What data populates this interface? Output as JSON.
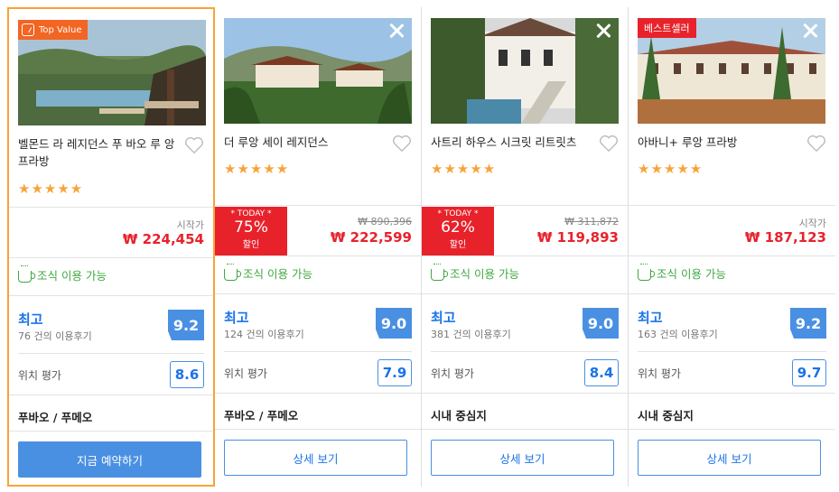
{
  "cards": [
    {
      "badge": "Top Value",
      "name": "벨몬드 라 레지던스 푸 바오 루 앙 프라방",
      "stars": "★★★★★",
      "start_label": "시작가",
      "price": "₩ 224,454",
      "breakfast": "조식 이용 가능",
      "rating_word": "최고",
      "reviews": "76 건의 이용후기",
      "score": "9.2",
      "location_label": "위치 평가",
      "location_score": "8.6",
      "area": "푸바오 / 푸메오",
      "button": "지금 예약하기"
    },
    {
      "name": "더 루앙 세이 레지던스",
      "stars": "★★★★★",
      "deal_today": "* TODAY *",
      "deal_percent": "75%",
      "deal_off": "할인",
      "original_price": "₩ 890,396",
      "price": "₩ 222,599",
      "breakfast": "조식 이용 가능",
      "rating_word": "최고",
      "reviews": "124 건의 이용후기",
      "score": "9.0",
      "location_label": "위치 평가",
      "location_score": "7.9",
      "area": "푸바오 / 푸메오",
      "button": "상세 보기"
    },
    {
      "name": "사트리 하우스 시크릿 리트릿츠",
      "stars": "★★★★★",
      "deal_today": "* TODAY *",
      "deal_percent": "62%",
      "deal_off": "할인",
      "original_price": "₩ 311,872",
      "price": "₩ 119,893",
      "breakfast": "조식 이용 가능",
      "rating_word": "최고",
      "reviews": "381 건의 이용후기",
      "score": "9.0",
      "location_label": "위치 평가",
      "location_score": "8.4",
      "area": "시내 중심지",
      "button": "상세 보기"
    },
    {
      "badge": "베스트셀러",
      "name": "아바니+ 루앙 프라방",
      "stars": "★★★★★",
      "start_label": "시작가",
      "price": "₩ 187,123",
      "breakfast": "조식 이용 가능",
      "rating_word": "최고",
      "reviews": "163 건의 이용후기",
      "score": "9.2",
      "location_label": "위치 평가",
      "location_score": "9.7",
      "area": "시내 중심지",
      "button": "상세 보기"
    }
  ],
  "colors": {
    "accent_orange": "#f7a33a",
    "deal_red": "#e8222b",
    "price_red": "#e8222b",
    "blue": "#4a90e2",
    "green": "#3fa83f"
  },
  "icons": [
    "value-tag-icon",
    "close-icon",
    "heart-icon",
    "star-icon",
    "coffee-cup-icon"
  ]
}
